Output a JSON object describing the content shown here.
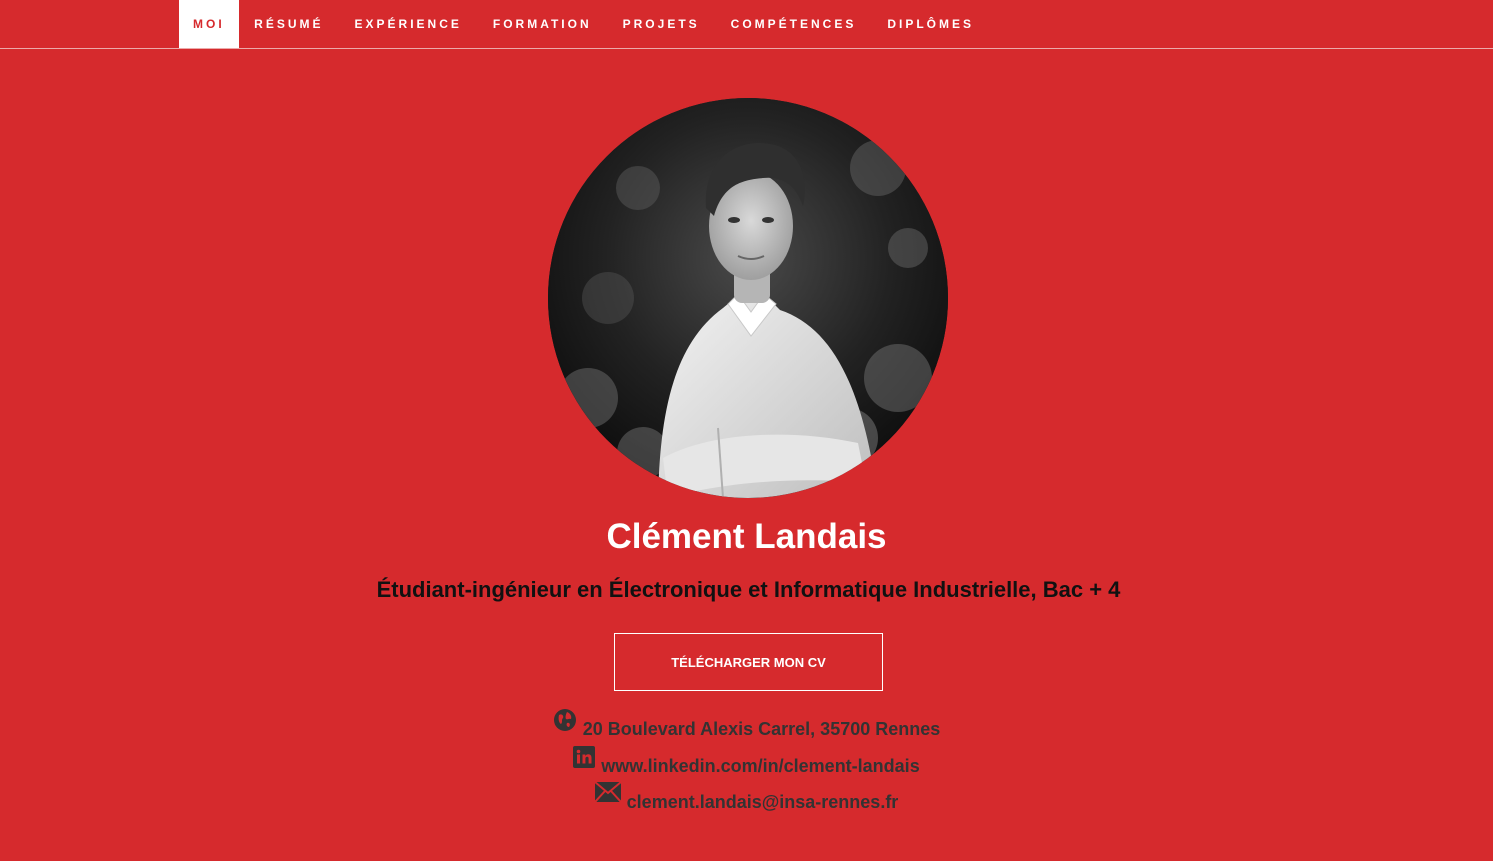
{
  "nav": {
    "items": [
      {
        "label": "MOI",
        "active": true
      },
      {
        "label": "RÉSUMÉ",
        "active": false
      },
      {
        "label": "EXPÉRIENCE",
        "active": false
      },
      {
        "label": "FORMATION",
        "active": false
      },
      {
        "label": "PROJETS",
        "active": false
      },
      {
        "label": "COMPÉTENCES",
        "active": false
      },
      {
        "label": "DIPLÔMES",
        "active": false
      }
    ]
  },
  "profile": {
    "photo_icon": "profile-photo",
    "name": "Clément Landais",
    "headline": "Étudiant-ingénieur en Électronique et Informatique Industrielle, Bac + 4",
    "cv_button": "TÉLÉCHARGER MON CV"
  },
  "contact": {
    "address": {
      "icon": "globe-icon",
      "text": "20 Boulevard Alexis Carrel, 35700 Rennes"
    },
    "linkedin": {
      "icon": "linkedin-icon",
      "text": "www.linkedin.com/in/clement-landais"
    },
    "email": {
      "icon": "envelope-icon",
      "text": "clement.landais@insa-rennes.fr"
    }
  },
  "colors": {
    "background": "#d62a2d",
    "nav_active_bg": "#ffffff",
    "text_dark": "#333333"
  }
}
